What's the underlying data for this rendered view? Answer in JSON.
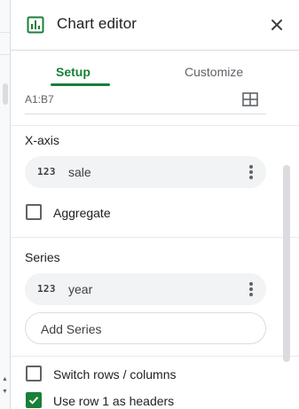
{
  "panel": {
    "title": "Chart editor",
    "tabs": [
      {
        "label": "Setup",
        "active": true
      },
      {
        "label": "Customize",
        "active": false
      }
    ]
  },
  "data_range": {
    "value": "A1:B7",
    "icon": "grid-select-icon"
  },
  "x_axis": {
    "label": "X-axis",
    "chip": {
      "type_icon": "123",
      "label": "sale",
      "menu_icon": "more-vert-icon"
    },
    "aggregate": {
      "label": "Aggregate",
      "checked": false
    }
  },
  "series": {
    "label": "Series",
    "chip": {
      "type_icon": "123",
      "label": "year",
      "menu_icon": "more-vert-icon"
    },
    "add_button": "Add Series"
  },
  "options": {
    "switch_rows": {
      "label": "Switch rows / columns",
      "checked": false
    },
    "use_headers": {
      "label": "Use row 1 as headers",
      "checked": true
    }
  },
  "colors": {
    "accent": "#188038",
    "chip_bg": "#f1f3f4",
    "text": "#202124",
    "muted": "#5f6368"
  }
}
